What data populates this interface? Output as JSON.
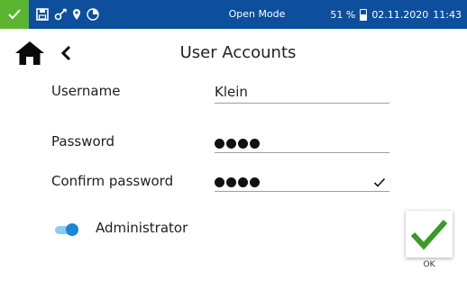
{
  "status_bar": {
    "mode": "Open Mode",
    "battery_percent": "51 %",
    "battery_level": 0.51,
    "date": "02.11.2020",
    "time": "11:43",
    "icons": [
      "check-icon",
      "save-icon",
      "probe-icon",
      "location-pin-icon",
      "pie-timer-icon"
    ]
  },
  "header": {
    "title": "User Accounts",
    "icons": [
      "home-icon",
      "back-chevron-icon"
    ]
  },
  "form": {
    "username": {
      "label": "Username",
      "value": "Klein"
    },
    "password": {
      "label": "Password",
      "masked_length": 4
    },
    "confirm_password": {
      "label": "Confirm password",
      "masked_length": 4,
      "matched": true
    },
    "administrator": {
      "label": "Administrator",
      "enabled": true
    }
  },
  "ok_button": {
    "label": "OK"
  },
  "colors": {
    "status_bar": "#0d4f9c",
    "status_ok": "#5cb531",
    "ok_check": "#3a9a2a",
    "toggle_on": "#1a86d8"
  }
}
